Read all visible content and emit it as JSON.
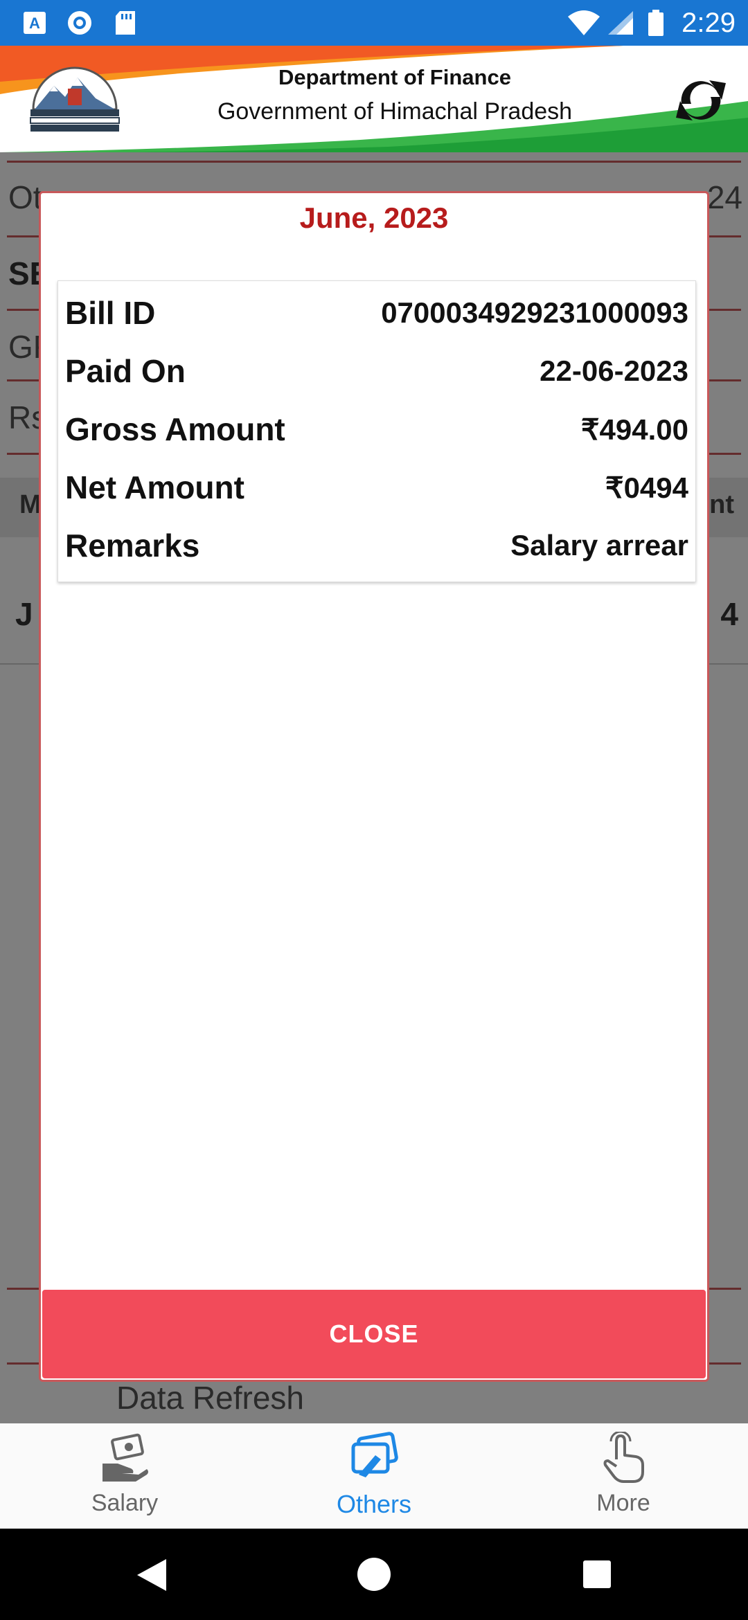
{
  "status_bar": {
    "time": "2:29"
  },
  "header": {
    "line1": "Department of Finance",
    "line2": "Government of Himachal Pradesh",
    "icons": [
      "state-emblem",
      "sync-icon"
    ]
  },
  "background": {
    "row1": "Ot",
    "row1_end": "24",
    "row2": "SE",
    "row3": "GF",
    "row4": "Rs",
    "col_start": "M",
    "col_end": "nt",
    "cell_start": "J",
    "cell_end": "4",
    "data_refresh_label": "Data Refresh"
  },
  "modal": {
    "title": "June, 2023",
    "rows": [
      {
        "label": "Bill ID",
        "value": "0700034929231000093"
      },
      {
        "label": "Paid On",
        "value": "22-06-2023"
      },
      {
        "label": "Gross Amount",
        "value": "₹494.00"
      },
      {
        "label": "Net Amount",
        "value": "₹0494"
      },
      {
        "label": "Remarks",
        "value": "Salary arrear"
      }
    ],
    "close_label": "CLOSE"
  },
  "nav": {
    "items": [
      {
        "label": "Salary",
        "icon": "salary-hand-icon"
      },
      {
        "label": "Others",
        "icon": "others-card-icon",
        "active": true
      },
      {
        "label": "More",
        "icon": "pointer-hand-icon"
      }
    ]
  },
  "colors": {
    "status_bar": "#1976d2",
    "accent_red": "#c8585a",
    "close_button": "#f24b5a",
    "nav_active": "#1e88e5",
    "nav_inactive": "#666666"
  }
}
